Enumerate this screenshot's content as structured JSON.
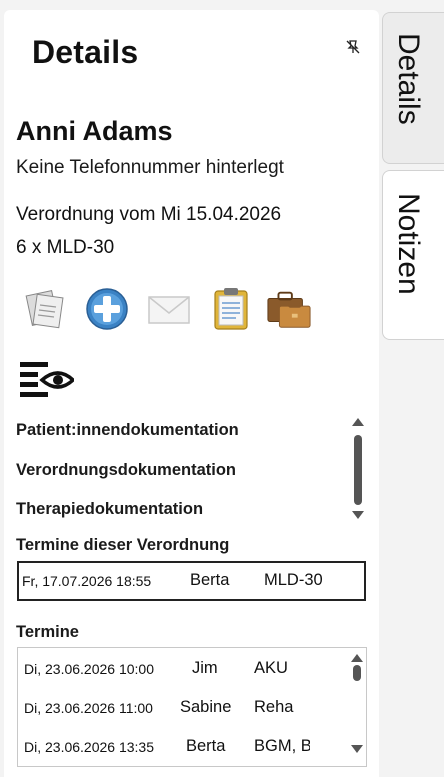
{
  "panel": {
    "title": "Details"
  },
  "patient": {
    "name": "Anni Adams",
    "phone_text": "Keine Telefonnummer hinterlegt",
    "prescription_text": "Verordnung vom Mi 15.04.2026",
    "therapy_text": "6 x MLD-30"
  },
  "toolbar": {
    "icons": [
      "notes-icon",
      "add-icon",
      "mail-icon",
      "clipboard-icon",
      "briefcase-icon"
    ]
  },
  "documentation": {
    "items": [
      {
        "label": "Patient:innendokumentation"
      },
      {
        "label": "Verordnungsdokumentation"
      },
      {
        "label": "Therapiedokumentation"
      }
    ]
  },
  "prescription_appointments": {
    "label": "Termine dieser Verordnung",
    "rows": [
      {
        "date": "Fr, 17.07.2026 18:55",
        "therapist": "Berta",
        "type": "MLD-30"
      }
    ]
  },
  "appointments": {
    "label": "Termine",
    "rows": [
      {
        "date": "Di, 23.06.2026 10:00",
        "therapist": "Jim",
        "type": "AKU"
      },
      {
        "date": "Di, 23.06.2026 11:00",
        "therapist": "Sabine",
        "type": "Reha"
      },
      {
        "date": "Di, 23.06.2026 13:35",
        "therapist": "Berta",
        "type": "BGM, B"
      }
    ]
  },
  "side_tabs": {
    "details": "Details",
    "notes": "Notizen"
  },
  "colors": {
    "accent_blue": "#3b82c4",
    "folder_brown": "#8a5a2b",
    "clipboard_yellow": "#e0b53a"
  }
}
